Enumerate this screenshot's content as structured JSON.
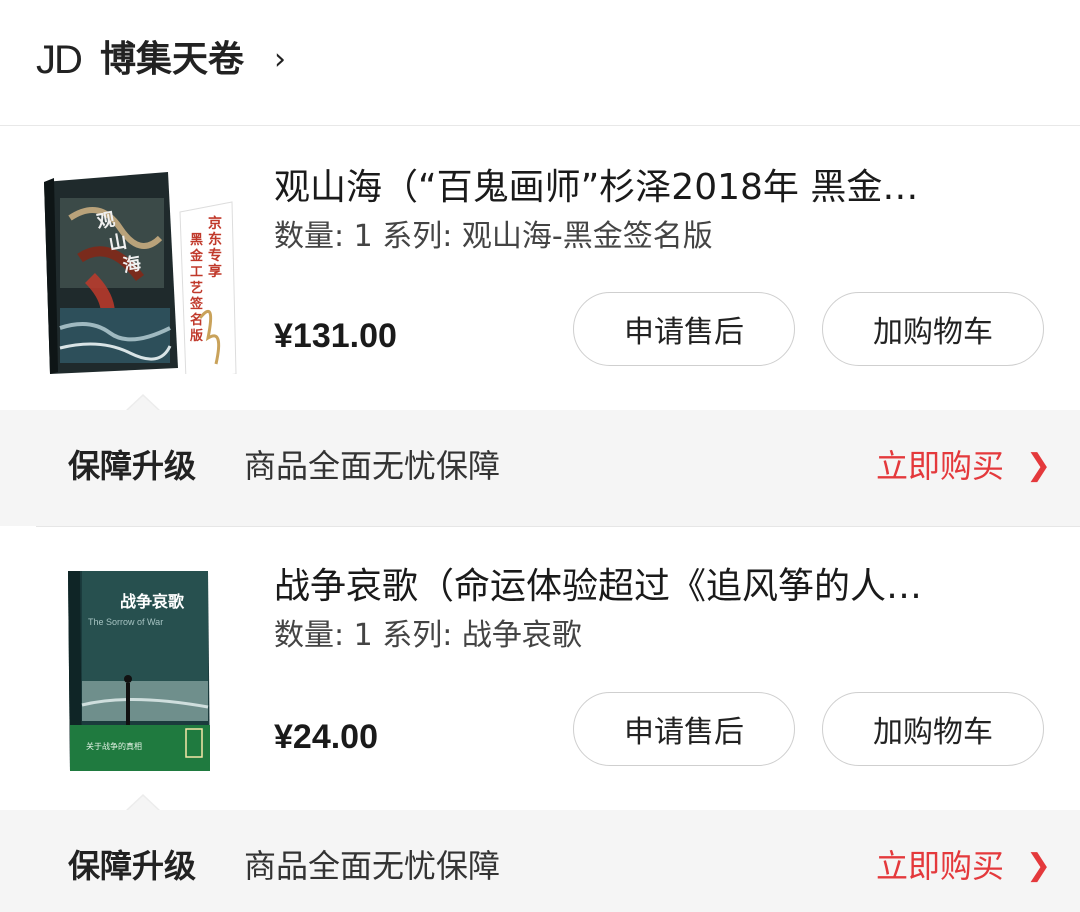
{
  "shop": {
    "logo": "JD",
    "name": "博集天卷",
    "chevron": "›"
  },
  "orders": [
    {
      "title": "观山海（“百鬼画师”杉泽2018年 黑金…",
      "spec": "数量: 1 系列: 观山海-黑金签名版",
      "price": "¥131.00",
      "cover_text": [
        "京东专享：",
        "黑金工艺签名版",
        "观山海"
      ],
      "buttons": {
        "after_sale": "申请售后",
        "add_cart": "加购物车"
      },
      "guarantee": {
        "label": "保障升级",
        "desc": "商品全面无忧保障",
        "buy": "立即购买",
        "chevron": "❯"
      }
    },
    {
      "title": "战争哀歌（命运体验超过《追风筝的人…",
      "spec": "数量: 1 系列: 战争哀歌",
      "price": "¥24.00",
      "cover_text": [
        "战争哀歌",
        "The Sorrow of War"
      ],
      "buttons": {
        "after_sale": "申请售后",
        "add_cart": "加购物车"
      },
      "guarantee": {
        "label": "保障升级",
        "desc": "商品全面无忧保障",
        "buy": "立即购买",
        "chevron": "❯"
      }
    }
  ],
  "colors": {
    "accent_red": "#e4393c",
    "guarantee_bg": "#f5f5f5",
    "button_border": "#cfcfcf"
  }
}
